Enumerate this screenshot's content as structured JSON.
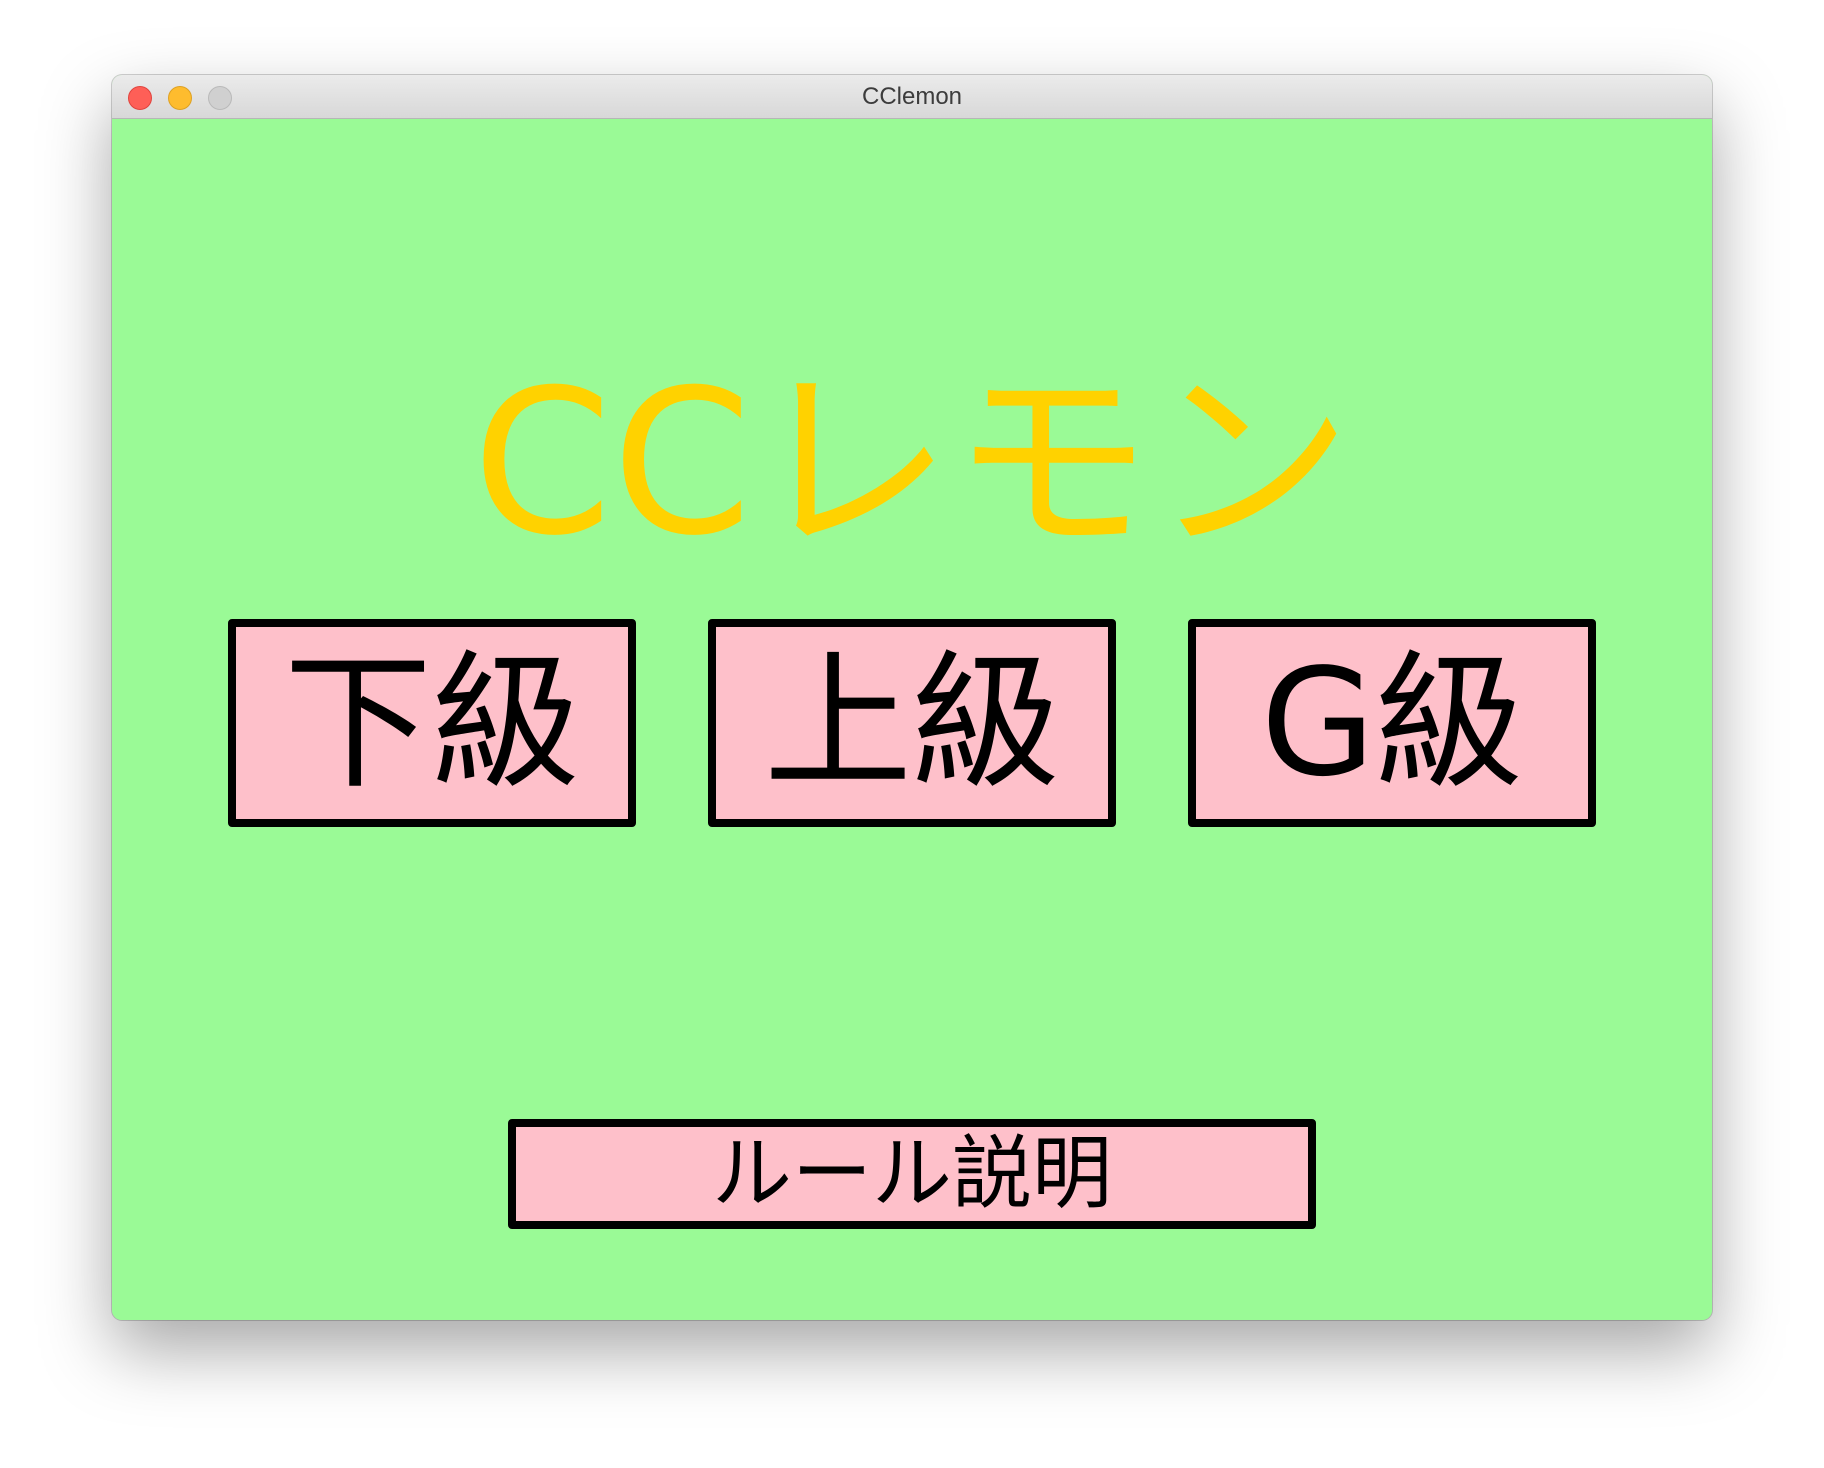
{
  "window": {
    "title": "CClemon"
  },
  "app": {
    "title": "CCレモン",
    "title_color": "#ffd200",
    "background_color": "#9afa96"
  },
  "levels": [
    {
      "label": "下級"
    },
    {
      "label": "上級"
    },
    {
      "label": "G級"
    }
  ],
  "rules_button": {
    "label": "ルール説明"
  },
  "colors": {
    "button_fill": "#fec0ca",
    "button_border": "#000000"
  }
}
